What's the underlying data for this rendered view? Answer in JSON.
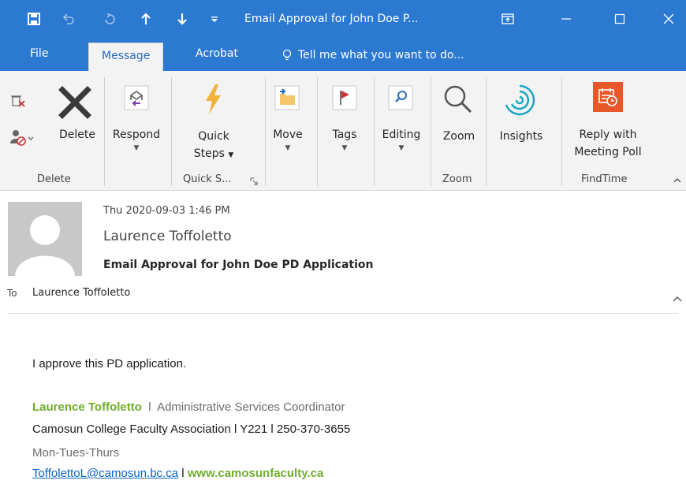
{
  "titlebar": {
    "title": "Email Approval for John Doe P...",
    "bg_color": "#2b79d1",
    "quick_access": [
      "save-icon",
      "undo-icon",
      "redo-icon",
      "previous-item-icon",
      "next-item-icon",
      "customize-icon"
    ],
    "window_controls": [
      "ribbon-display-icon",
      "minimize-icon",
      "maximize-icon",
      "close-icon"
    ]
  },
  "tabs": {
    "items": [
      "File",
      "Message",
      "Acrobat"
    ],
    "active": "Message",
    "tell_me": "Tell me what you want to do..."
  },
  "ribbon": {
    "delete": {
      "label": "Delete",
      "group": "Delete"
    },
    "respond": {
      "label": "Respond"
    },
    "quick_steps": {
      "line1": "Quick",
      "line2": "Steps",
      "group": "Quick S..."
    },
    "move": {
      "label": "Move"
    },
    "tags": {
      "label": "Tags"
    },
    "editing": {
      "label": "Editing"
    },
    "zoom": {
      "label": "Zoom",
      "group": "Zoom"
    },
    "insights": {
      "label": "Insights"
    },
    "findtime": {
      "line1": "Reply with",
      "line2": "Meeting Poll",
      "group": "FindTime"
    }
  },
  "header": {
    "date": "Thu 2020-09-03 1:46 PM",
    "from": "Laurence Toffoletto",
    "subject": "Email Approval for John Doe PD Application",
    "to_label": "To",
    "to": "Laurence Toffoletto"
  },
  "body": {
    "message": "I approve this PD application.",
    "signature": {
      "name": "Laurence Toffoletto",
      "sep1": "  l  ",
      "title": "Administrative Services Coordinator",
      "org_line": "Camosun College Faculty Association l  Y221  l  250-370-3655",
      "days": "Mon-Tues-Thurs",
      "email": "ToffolettoL@camosun.bc.ca",
      "sep2": " l ",
      "website": "www.camosunfaculty.ca"
    }
  }
}
